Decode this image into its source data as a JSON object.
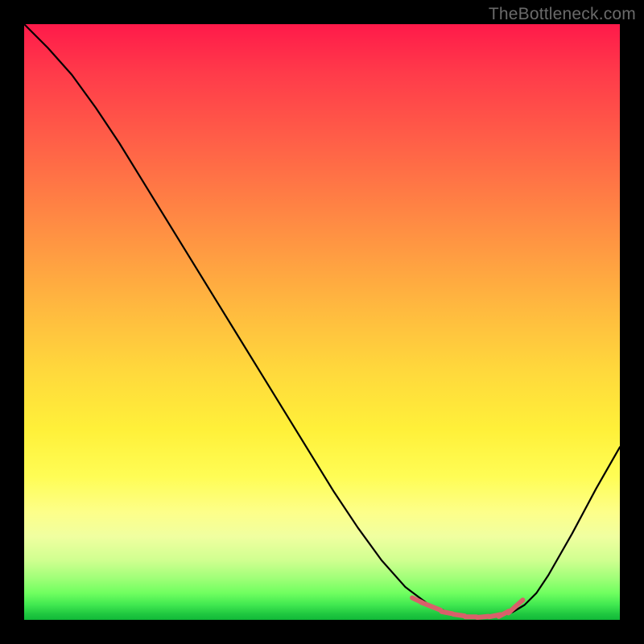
{
  "watermark": "TheBottleneck.com",
  "chart_data": {
    "type": "line",
    "title": "",
    "xlabel": "",
    "ylabel": "",
    "xlim": [
      0,
      100
    ],
    "ylim": [
      0,
      100
    ],
    "grid": false,
    "series": [
      {
        "name": "bottleneck-curve",
        "x": [
          0,
          4,
          8,
          12,
          16,
          20,
          24,
          28,
          32,
          36,
          40,
          44,
          48,
          52,
          56,
          60,
          64,
          68,
          72,
          76,
          80,
          82,
          84,
          86,
          88,
          92,
          96,
          100
        ],
        "y": [
          100,
          96,
          91.5,
          86,
          80,
          73.5,
          67,
          60.5,
          54,
          47.5,
          41,
          34.5,
          28,
          21.5,
          15.5,
          10,
          5.5,
          2.5,
          1.0,
          0.5,
          0.7,
          1.3,
          2.5,
          4.5,
          7.5,
          14.5,
          22,
          29
        ],
        "color": "#000000"
      },
      {
        "name": "optimal-zone-markers",
        "x": [
          66,
          67.5,
          69,
          71,
          73,
          75,
          77,
          79,
          80.5,
          82,
          83
        ],
        "y": [
          3.3,
          2.6,
          2.0,
          1.2,
          0.8,
          0.5,
          0.5,
          0.7,
          1.0,
          1.8,
          2.7
        ],
        "color": "#d9606a"
      }
    ],
    "background_gradient": {
      "type": "vertical",
      "stops": [
        {
          "pos": 0.0,
          "color": "#ff1a4a"
        },
        {
          "pos": 0.5,
          "color": "#ffc03e"
        },
        {
          "pos": 0.78,
          "color": "#fffd55"
        },
        {
          "pos": 0.92,
          "color": "#a0ff78"
        },
        {
          "pos": 1.0,
          "color": "#10b838"
        }
      ]
    }
  }
}
